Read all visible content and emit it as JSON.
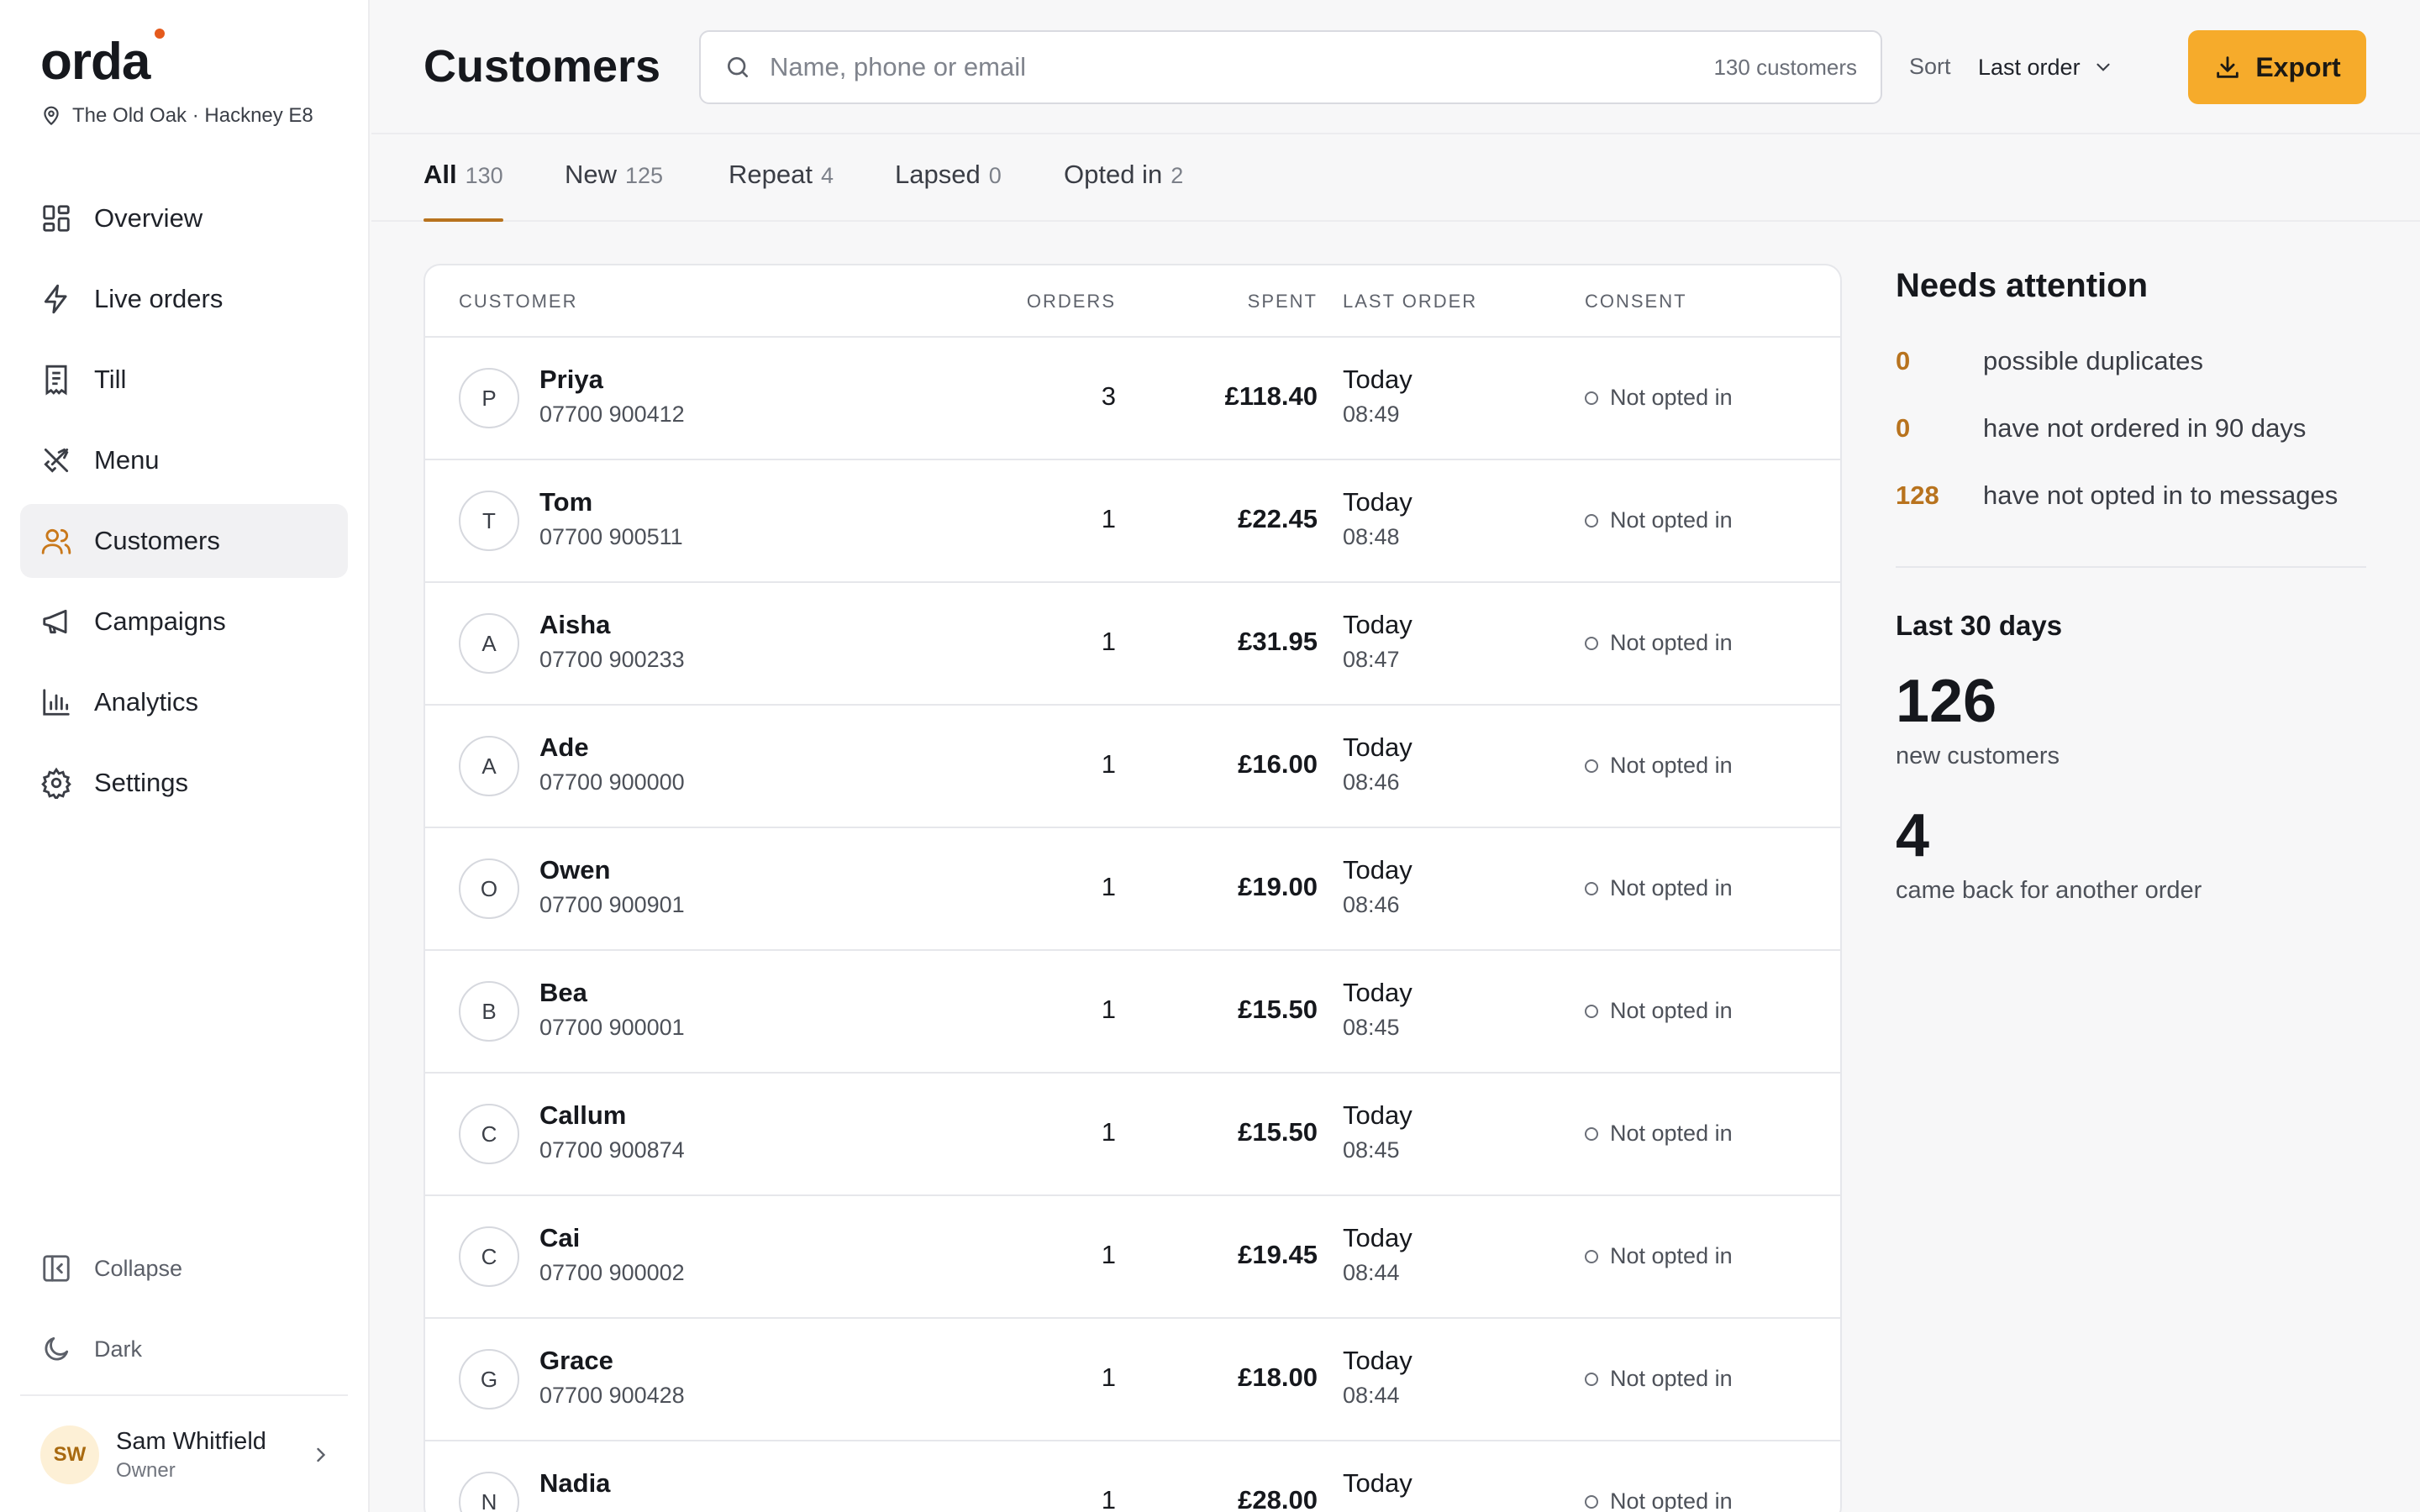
{
  "brand": {
    "logo": "orda",
    "venue": "The Old Oak · Hackney E8",
    "accent": "#f6ab2b",
    "accent_dark": "#b8731e",
    "dot": "#e55a1c"
  },
  "sidebar": {
    "items": [
      {
        "label": "Overview",
        "icon": "grid-icon"
      },
      {
        "label": "Live orders",
        "icon": "lightning-icon"
      },
      {
        "label": "Till",
        "icon": "receipt-icon"
      },
      {
        "label": "Menu",
        "icon": "utensils-icon"
      },
      {
        "label": "Customers",
        "icon": "users-icon",
        "active": true
      },
      {
        "label": "Campaigns",
        "icon": "megaphone-icon"
      },
      {
        "label": "Analytics",
        "icon": "bar-chart-icon"
      },
      {
        "label": "Settings",
        "icon": "gear-icon"
      }
    ],
    "collapse_label": "Collapse",
    "dark_label": "Dark",
    "user": {
      "initials": "SW",
      "name": "Sam Whitfield",
      "role": "Owner"
    }
  },
  "header": {
    "title": "Customers",
    "search_placeholder": "Name, phone or email",
    "search_count": "130 customers",
    "sort_label": "Sort",
    "sort_value": "Last order",
    "export_label": "Export"
  },
  "tabs": [
    {
      "label": "All",
      "count": "130",
      "active": true
    },
    {
      "label": "New",
      "count": "125"
    },
    {
      "label": "Repeat",
      "count": "4"
    },
    {
      "label": "Lapsed",
      "count": "0"
    },
    {
      "label": "Opted in",
      "count": "2"
    }
  ],
  "table": {
    "headers": {
      "customer": "CUSTOMER",
      "orders": "ORDERS",
      "spent": "SPENT",
      "last_order": "LAST ORDER",
      "consent": "CONSENT"
    },
    "rows": [
      {
        "initial": "P",
        "name": "Priya",
        "phone": "07700 900412",
        "orders": "3",
        "spent": "£118.40",
        "day": "Today",
        "time": "08:49",
        "consent": "Not opted in"
      },
      {
        "initial": "T",
        "name": "Tom",
        "phone": "07700 900511",
        "orders": "1",
        "spent": "£22.45",
        "day": "Today",
        "time": "08:48",
        "consent": "Not opted in"
      },
      {
        "initial": "A",
        "name": "Aisha",
        "phone": "07700 900233",
        "orders": "1",
        "spent": "£31.95",
        "day": "Today",
        "time": "08:47",
        "consent": "Not opted in"
      },
      {
        "initial": "A",
        "name": "Ade",
        "phone": "07700 900000",
        "orders": "1",
        "spent": "£16.00",
        "day": "Today",
        "time": "08:46",
        "consent": "Not opted in"
      },
      {
        "initial": "O",
        "name": "Owen",
        "phone": "07700 900901",
        "orders": "1",
        "spent": "£19.00",
        "day": "Today",
        "time": "08:46",
        "consent": "Not opted in"
      },
      {
        "initial": "B",
        "name": "Bea",
        "phone": "07700 900001",
        "orders": "1",
        "spent": "£15.50",
        "day": "Today",
        "time": "08:45",
        "consent": "Not opted in"
      },
      {
        "initial": "C",
        "name": "Callum",
        "phone": "07700 900874",
        "orders": "1",
        "spent": "£15.50",
        "day": "Today",
        "time": "08:45",
        "consent": "Not opted in"
      },
      {
        "initial": "C",
        "name": "Cai",
        "phone": "07700 900002",
        "orders": "1",
        "spent": "£19.45",
        "day": "Today",
        "time": "08:44",
        "consent": "Not opted in"
      },
      {
        "initial": "G",
        "name": "Grace",
        "phone": "07700 900428",
        "orders": "1",
        "spent": "£18.00",
        "day": "Today",
        "time": "08:44",
        "consent": "Not opted in"
      },
      {
        "initial": "N",
        "name": "Nadia",
        "phone": "",
        "orders": "1",
        "spent": "£28.00",
        "day": "Today",
        "time": "",
        "consent": "Not opted in"
      }
    ]
  },
  "panel": {
    "title": "Needs attention",
    "items": [
      {
        "num": "0",
        "text": "possible duplicates"
      },
      {
        "num": "0",
        "text": "have not ordered in 90 days"
      },
      {
        "num": "128",
        "text": "have not opted in to messages"
      }
    ],
    "period_title": "Last 30 days",
    "new_customers_num": "126",
    "new_customers_label": "new customers",
    "returning_num": "4",
    "returning_label": "came back for another order"
  }
}
